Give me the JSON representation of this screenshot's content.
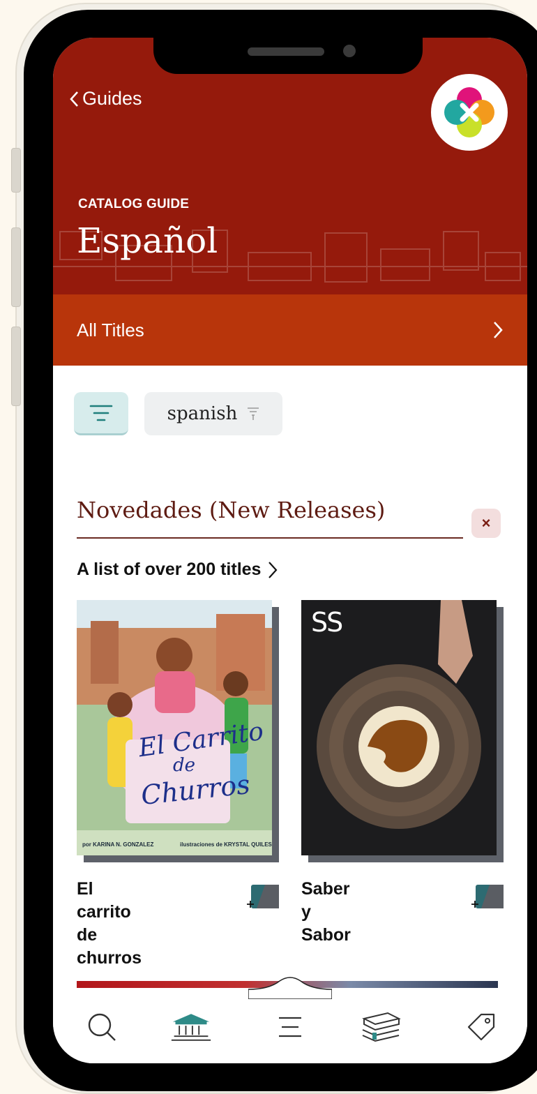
{
  "header": {
    "back_label": "Guides",
    "eyebrow": "CATALOG GUIDE",
    "title": "Español"
  },
  "all_titles": {
    "label": "All Titles"
  },
  "filter": {
    "chip_label": "spanish"
  },
  "section": {
    "title": "Novedades (New Releases)",
    "list_link": "A list of over 200 titles"
  },
  "books": [
    {
      "title_line1": "El carrito de",
      "title_line2": "churros",
      "cover_title_1": "El Carrito",
      "cover_title_2": "de",
      "cover_title_3": "Churros",
      "cover_author": "por KARINA N. GONZALEZ",
      "cover_illustrator": "ilustraciones de KRYSTAL QUILES"
    },
    {
      "title_line1": "Saber y Sabor",
      "cover_logo": "SS"
    }
  ],
  "tabs": [
    {
      "icon": "search-icon"
    },
    {
      "icon": "library-icon"
    },
    {
      "icon": "menu-icon"
    },
    {
      "icon": "shelf-icon"
    },
    {
      "icon": "tag-icon"
    }
  ],
  "colors": {
    "header": "#951a0c",
    "banner": "#b8350b",
    "accent": "#2e8b88",
    "section_title": "#5e1b12"
  }
}
